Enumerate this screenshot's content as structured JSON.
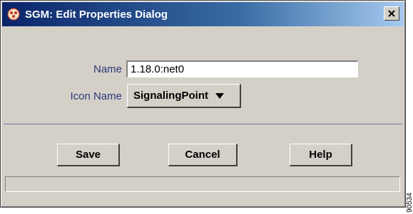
{
  "window": {
    "title": "SGM: Edit Properties Dialog",
    "app_icon": "sgm-app-icon",
    "close_icon": "close-icon"
  },
  "form": {
    "name_label": "Name",
    "name_value": "1.18.0:net0",
    "icon_name_label": "Icon Name",
    "icon_name_value": "SignalingPoint",
    "dropdown_icon": "triangle-down-icon"
  },
  "buttons": {
    "save": "Save",
    "cancel": "Cancel",
    "help": "Help"
  },
  "status_bar": {
    "text": ""
  },
  "side_label": "90534",
  "colors": {
    "dialog_bg": "#d4d0c8",
    "title_bar": "#0a246a",
    "label_color": "#2c3a78",
    "separator": "#6b73a8"
  }
}
